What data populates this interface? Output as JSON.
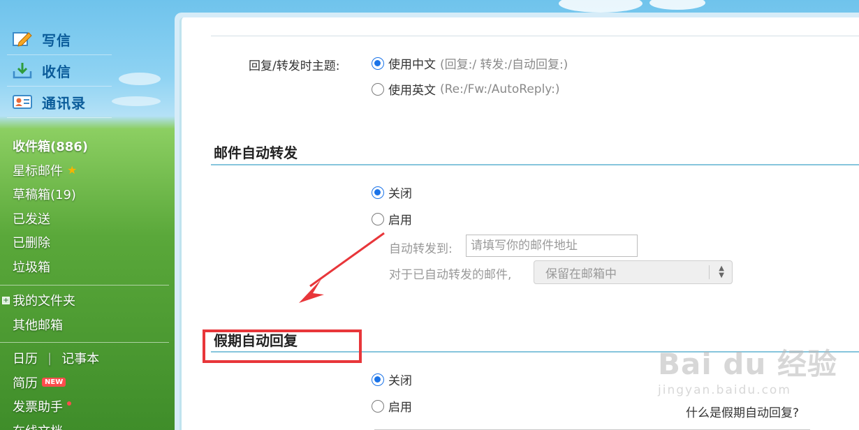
{
  "sidebar": {
    "primary": [
      {
        "label": "写信",
        "icon": "compose-icon"
      },
      {
        "label": "收信",
        "icon": "inbox-download-icon"
      },
      {
        "label": "通讯录",
        "icon": "contacts-card-icon"
      }
    ],
    "folders": {
      "inbox": "收件箱(886)",
      "starred": "星标邮件",
      "drafts": "草稿箱(19)",
      "sent": "已发送",
      "deleted": "已删除",
      "trash": "垃圾箱",
      "my_folders": "我的文件夹",
      "other_mailboxes": "其他邮箱"
    },
    "tools": {
      "calendar": "日历",
      "notepad": "记事本",
      "resume": "简历",
      "new_badge": "NEW",
      "invoice": "发票助手",
      "online_docs": "在线文档"
    }
  },
  "settings": {
    "reply_subject": {
      "label": "回复/转发时主题:",
      "options": [
        {
          "label": "使用中文",
          "hint": "(回复:/ 转发:/自动回复:)",
          "selected": true
        },
        {
          "label": "使用英文",
          "hint": "(Re:/Fw:/AutoReply:)",
          "selected": false
        }
      ]
    },
    "auto_forward": {
      "title": "邮件自动转发",
      "options": [
        {
          "label": "关闭",
          "selected": true
        },
        {
          "label": "启用",
          "selected": false
        }
      ],
      "forward_to_label": "自动转发到:",
      "forward_to_placeholder": "请填写你的邮件地址",
      "after_forward_label": "对于已自动转发的邮件,",
      "after_forward_value": "保留在邮箱中"
    },
    "vacation_reply": {
      "title": "假期自动回复",
      "options": [
        {
          "label": "关闭",
          "selected": true
        },
        {
          "label": "启用",
          "selected": false
        }
      ],
      "help_link": "什么是假期自动回复?"
    }
  },
  "watermark": {
    "main": "Bai du 经验",
    "sub": "jingyan.baidu.com"
  },
  "colors": {
    "accent": "#1a73e8",
    "section_rule": "#86c5dc",
    "highlight": "#e8363a",
    "nav_text": "#0b5c9a"
  }
}
